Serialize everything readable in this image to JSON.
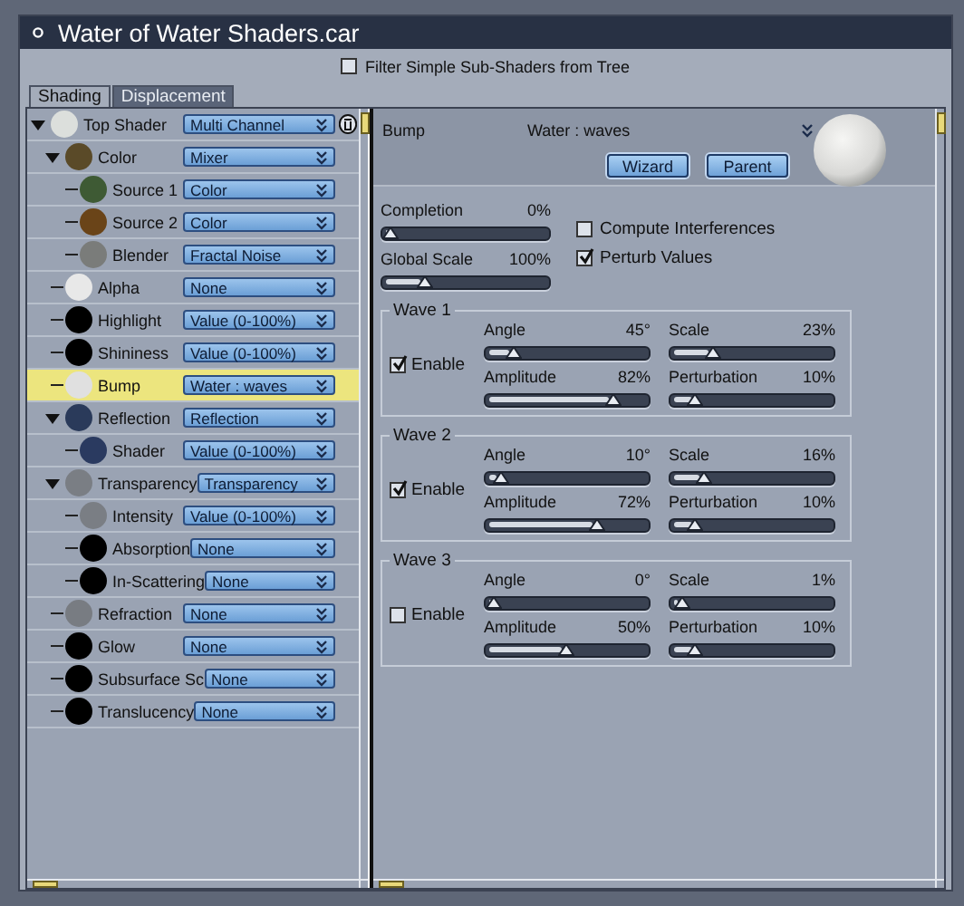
{
  "window": {
    "title": "Water of Water Shaders.car"
  },
  "filter": {
    "label": "Filter Simple Sub-Shaders from Tree",
    "checked": false
  },
  "tabs": [
    {
      "label": "Shading",
      "selected": true
    },
    {
      "label": "Displacement",
      "selected": false
    }
  ],
  "tree": [
    {
      "label": "Top Shader",
      "value": "Multi Channel",
      "color": "#dcdfdc",
      "expanded": true,
      "selected": false,
      "children": [
        {
          "label": "Color",
          "value": "Mixer",
          "color": "#5a4a28",
          "expanded": true,
          "selected": false,
          "children": [
            {
              "label": "Source 1",
              "value": "Color",
              "color": "#3e5a34",
              "selected": false
            },
            {
              "label": "Source 2",
              "value": "Color",
              "color": "#6a4418",
              "selected": false
            },
            {
              "label": "Blender",
              "value": "Fractal Noise",
              "color": "#7a7c7a",
              "selected": false
            }
          ]
        },
        {
          "label": "Alpha",
          "value": "None",
          "color": "#e8e8e8",
          "selected": false
        },
        {
          "label": "Highlight",
          "value": "Value (0-100%)",
          "color": "#000000",
          "selected": false
        },
        {
          "label": "Shininess",
          "value": "Value (0-100%)",
          "color": "#000000",
          "selected": false
        },
        {
          "label": "Bump",
          "value": "Water : waves",
          "color": "#e0e0e0",
          "selected": true
        },
        {
          "label": "Reflection",
          "value": "Reflection",
          "color": "#2a3a5a",
          "expanded": true,
          "selected": false,
          "children": [
            {
              "label": "Shader",
              "value": "Value (0-100%)",
              "color": "#2a3a60",
              "selected": false
            }
          ]
        },
        {
          "label": "Transparency",
          "value": "Transparency",
          "color": "#7a7e84",
          "expanded": true,
          "selected": false,
          "children": [
            {
              "label": "Intensity",
              "value": "Value (0-100%)",
              "color": "#7a7e84",
              "selected": false
            },
            {
              "label": "Absorption",
              "value": "None",
              "color": "#000000",
              "selected": false
            },
            {
              "label": "In-Scattering",
              "value": "None",
              "color": "#000000",
              "selected": false
            }
          ]
        },
        {
          "label": "Refraction",
          "value": "None",
          "color": "#787c82",
          "selected": false
        },
        {
          "label": "Glow",
          "value": "None",
          "color": "#000000",
          "selected": false
        },
        {
          "label": "Subsurface Sc",
          "value": "None",
          "color": "#000000",
          "selected": false
        },
        {
          "label": "Translucency",
          "value": "None",
          "color": "#000000",
          "selected": false
        }
      ]
    }
  ],
  "editor": {
    "label": "Bump",
    "shader": "Water : waves",
    "buttons": [
      "Wizard",
      "Parent"
    ],
    "sliders": [
      {
        "label": "Completion",
        "reading": "0%",
        "level": 0.05
      },
      {
        "label": "Global Scale",
        "reading": "100%",
        "level": 0.25
      }
    ],
    "options": [
      {
        "label": "Compute Interferences",
        "checked": false
      },
      {
        "label": "Perturb Values",
        "checked": true
      }
    ],
    "waves": [
      {
        "title": "Wave 1",
        "enable": {
          "label": "Enable",
          "checked": true
        },
        "sliders": [
          {
            "label": "Angle",
            "reading": "45°",
            "level": 0.17
          },
          {
            "label": "Scale",
            "reading": "23%",
            "level": 0.26
          },
          {
            "label": "Amplitude",
            "reading": "82%",
            "level": 0.78
          },
          {
            "label": "Perturbation",
            "reading": "10%",
            "level": 0.15
          }
        ]
      },
      {
        "title": "Wave 2",
        "enable": {
          "label": "Enable",
          "checked": true
        },
        "sliders": [
          {
            "label": "Angle",
            "reading": "10°",
            "level": 0.09
          },
          {
            "label": "Scale",
            "reading": "16%",
            "level": 0.2
          },
          {
            "label": "Amplitude",
            "reading": "72%",
            "level": 0.68
          },
          {
            "label": "Perturbation",
            "reading": "10%",
            "level": 0.15
          }
        ]
      },
      {
        "title": "Wave 3",
        "enable": {
          "label": "Enable",
          "checked": false
        },
        "sliders": [
          {
            "label": "Angle",
            "reading": "0°",
            "level": 0.05
          },
          {
            "label": "Scale",
            "reading": "1%",
            "level": 0.07
          },
          {
            "label": "Amplitude",
            "reading": "50%",
            "level": 0.49
          },
          {
            "label": "Perturbation",
            "reading": "10%",
            "level": 0.15
          }
        ]
      }
    ]
  }
}
